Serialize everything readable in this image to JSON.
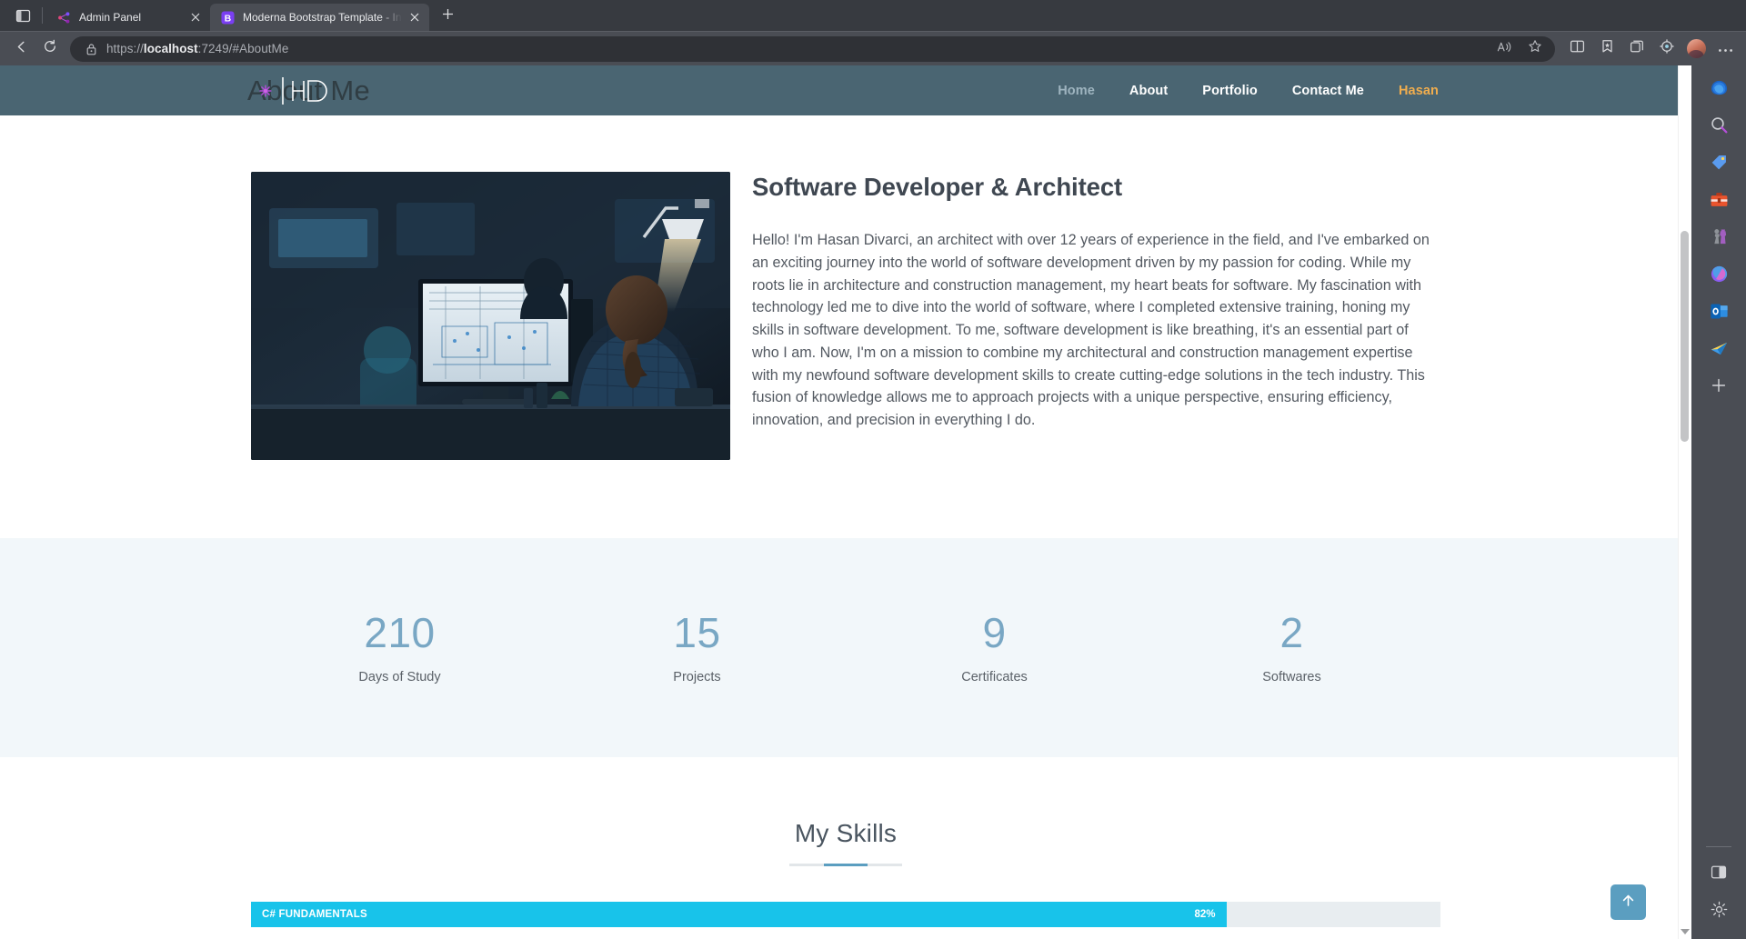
{
  "browser": {
    "tab_overview_icon": "tab-overview-icon",
    "tabs": [
      {
        "title": "Admin Panel",
        "favicon": "share-nodes-icon",
        "active": false,
        "close_label": "×"
      },
      {
        "title": "Moderna Bootstrap Template - In",
        "favicon": "letter-b-icon",
        "active": true,
        "close_label": "×"
      }
    ],
    "new_tab_label": "+",
    "back_icon": "back-arrow-icon",
    "reload_icon": "reload-icon",
    "lock_icon": "lock-icon",
    "url_prefix": "https://",
    "url_host": "localhost",
    "url_rest": ":7249/#AboutMe",
    "url_full": "https://localhost:7249/#AboutMe",
    "omnibox_right_icons": [
      "read-aloud-icon",
      "favorite-star-icon"
    ],
    "toolbar_icons": [
      "split-screen-icon",
      "favorites-icon",
      "collections-icon",
      "browser-essentials-icon"
    ],
    "profile_avatar": "avatar",
    "settings_more_icon": "more-options-icon",
    "copilot_icon": "copilot-icon",
    "rail_icons": [
      "copilot-icon",
      "search-icon",
      "shopping-tag-icon",
      "tools-icon",
      "games-icon",
      "microsoft-365-icon",
      "outlook-icon",
      "send-icon",
      "add-icon"
    ],
    "rail_bottom_icons": [
      "split-pane-icon",
      "settings-gear-icon"
    ]
  },
  "site": {
    "brand": {
      "text": "About Me",
      "logo": "HD",
      "spark_icon": "sparkle-icon"
    },
    "nav": [
      {
        "label": "Home",
        "state": "muted"
      },
      {
        "label": "About",
        "state": "active"
      },
      {
        "label": "Portfolio",
        "state": "normal"
      },
      {
        "label": "Contact Me",
        "state": "normal"
      },
      {
        "label": "Hasan",
        "state": "gold"
      }
    ],
    "about": {
      "image_alt": "developer-workstation-photo",
      "heading": "Software Developer & Architect",
      "paragraph": "Hello! I'm Hasan Divarci, an architect with over 12 years of experience in the field, and I've embarked on an exciting journey into the world of software development driven by my passion for coding. While my roots lie in architecture and construction management, my heart beats for software. My fascination with technology led me to dive into the world of software, where I completed extensive training, honing my skills in software development. To me, software development is like breathing, it's an essential part of who I am. Now, I'm on a mission to combine my architectural and construction management expertise with my newfound software development skills to create cutting-edge solutions in the tech industry. This fusion of knowledge allows me to approach projects with a unique perspective, ensuring efficiency, innovation, and precision in everything I do."
    },
    "stats": [
      {
        "value": "210",
        "label": "Days of Study"
      },
      {
        "value": "15",
        "label": "Projects"
      },
      {
        "value": "9",
        "label": "Certificates"
      },
      {
        "value": "2",
        "label": "Softwares"
      }
    ],
    "skills": {
      "title": "My Skills",
      "bars": [
        {
          "name": "C# FUNDAMENTALS",
          "percent_label": "82%",
          "percent": 82
        }
      ]
    },
    "to_top_label": "↑",
    "colors": {
      "header_bg": "#4a6572",
      "nav_gold": "#f0ad4e",
      "stat_number": "#79a7c4",
      "stats_bg": "#f2f7fa",
      "skill_fill": "#18c3ea",
      "accent": "#5b9ec0"
    }
  }
}
